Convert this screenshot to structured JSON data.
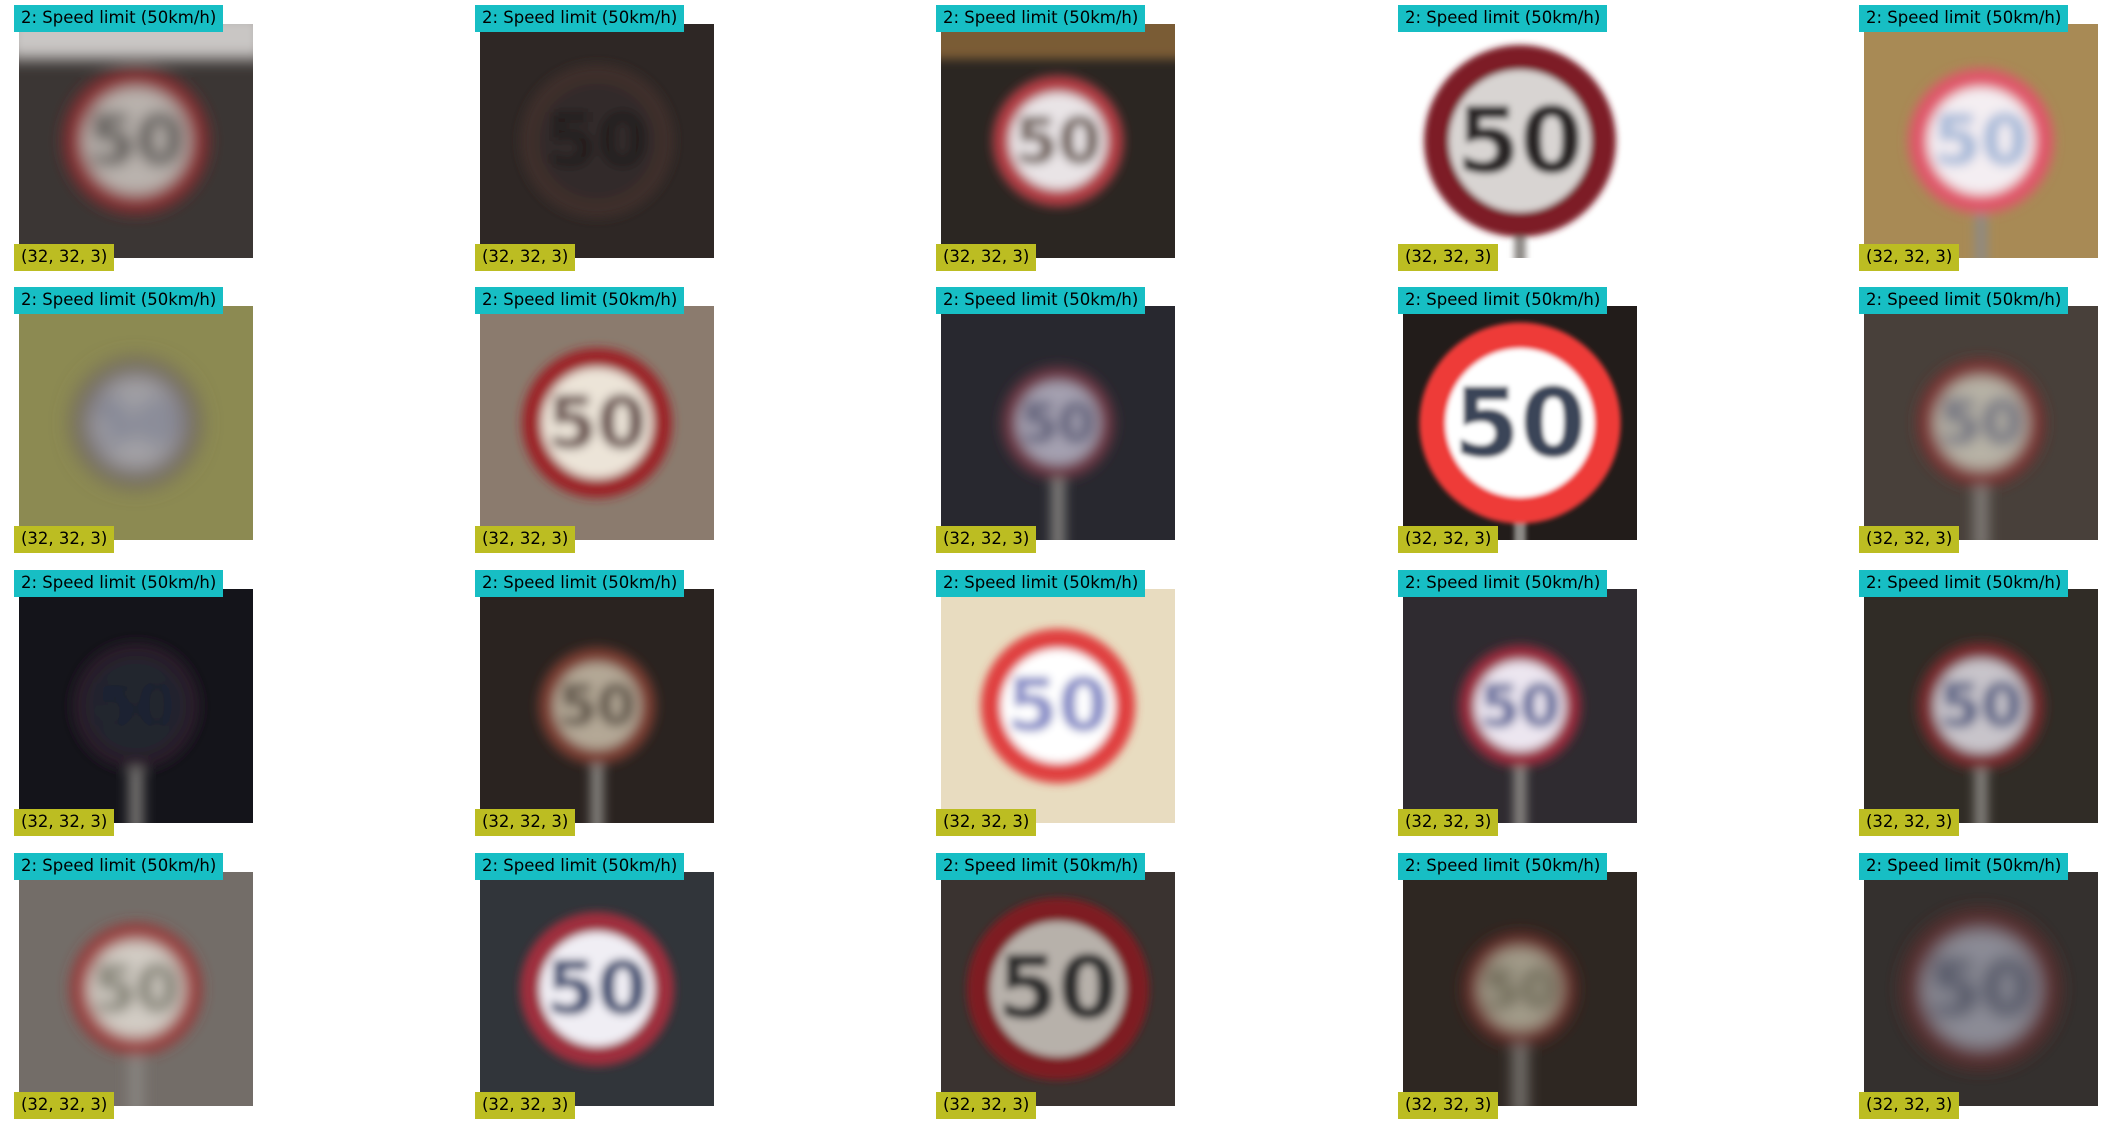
{
  "colors": {
    "class_label_bg": "#17bec4",
    "shape_label_bg": "#bcbd22"
  },
  "panels": [
    {
      "class_label": "2: Speed limit (50km/h)",
      "shape": "(32, 32, 3)",
      "bg": "#3b3634",
      "top_band": "#c9c6c4",
      "ring": "#8a2f33",
      "face": "#b9b2ad",
      "digits": "#3d3a38",
      "blur": 3.2,
      "scale": 0.62,
      "pole": false
    },
    {
      "class_label": "2: Speed limit (50km/h)",
      "shape": "(32, 32, 3)",
      "bg": "#2e2725",
      "top_band": "",
      "ring": "#3e2d2b",
      "face": "#332b29",
      "digits": "#231d1c",
      "blur": 2.2,
      "scale": 0.66,
      "pole": false
    },
    {
      "class_label": "2: Speed limit (50km/h)",
      "shape": "(32, 32, 3)",
      "bg": "#2b2622",
      "top_band": "#7a5b34",
      "ring": "#b23d45",
      "face": "#e9e4e6",
      "digits": "#5d4a3c",
      "blur": 2.2,
      "scale": 0.56,
      "pole": false
    },
    {
      "class_label": "2: Speed limit (50km/h)",
      "shape": "(32, 32, 3)",
      "bg": "#ffffff",
      "top_band": "",
      "ring": "#7d1f26",
      "face": "#d8d4d2",
      "digits": "#2b2727",
      "blur": 1.4,
      "scale": 0.82,
      "pole": true
    },
    {
      "class_label": "2: Speed limit (50km/h)",
      "shape": "(32, 32, 3)",
      "bg": "#a88a55",
      "top_band": "",
      "ring": "#e0566a",
      "face": "#f4eef2",
      "digits": "#9eb4d6",
      "blur": 2.4,
      "scale": 0.62,
      "pole": true
    },
    {
      "class_label": "2: Speed limit (50km/h)",
      "shape": "(32, 32, 3)",
      "bg": "#8c8a52",
      "top_band": "",
      "ring": "#6a6160",
      "face": "#a6a4a8",
      "digits": "#6a7188",
      "blur": 4.6,
      "scale": 0.54,
      "pole": false
    },
    {
      "class_label": "2: Speed limit (50km/h)",
      "shape": "(32, 32, 3)",
      "bg": "#8b7b6e",
      "top_band": "",
      "ring": "#9c2227",
      "face": "#ece4d8",
      "digits": "#5b3d3a",
      "blur": 2.2,
      "scale": 0.64,
      "pole": false
    },
    {
      "class_label": "2: Speed limit (50km/h)",
      "shape": "(32, 32, 3)",
      "bg": "#28282f",
      "top_band": "",
      "ring": "#6e3744",
      "face": "#a4a0b0",
      "digits": "#4c4d6c",
      "blur": 2.6,
      "scale": 0.48,
      "pole": true
    },
    {
      "class_label": "2: Speed limit (50km/h)",
      "shape": "(32, 32, 3)",
      "bg": "#221c1a",
      "top_band": "",
      "ring": "#ee3a38",
      "face": "#ffffff",
      "digits": "#3b4458",
      "blur": 1.0,
      "scale": 0.86,
      "pole": true
    },
    {
      "class_label": "2: Speed limit (50km/h)",
      "shape": "(32, 32, 3)",
      "bg": "#48403a",
      "top_band": "",
      "ring": "#7e3030",
      "face": "#b7b2a6",
      "digits": "#5a5f76",
      "blur": 3.0,
      "scale": 0.54,
      "pole": true
    },
    {
      "class_label": "2: Speed limit (50km/h)",
      "shape": "(32, 32, 3)",
      "bg": "#14141a",
      "top_band": "",
      "ring": "#2b1f29",
      "face": "#24252d",
      "digits": "#1c2430",
      "blur": 2.8,
      "scale": 0.54,
      "pole": true
    },
    {
      "class_label": "2: Speed limit (50km/h)",
      "shape": "(32, 32, 3)",
      "bg": "#2a2320",
      "top_band": "",
      "ring": "#7c3c33",
      "face": "#b4a896",
      "digits": "#4a3c32",
      "blur": 2.4,
      "scale": 0.5,
      "pole": true
    },
    {
      "class_label": "2: Speed limit (50km/h)",
      "shape": "(32, 32, 3)",
      "bg": "#e8dcc0",
      "top_band": "",
      "ring": "#e0413f",
      "face": "#ffffff",
      "digits": "#8a8fc8",
      "blur": 1.8,
      "scale": 0.66,
      "pole": false
    },
    {
      "class_label": "2: Speed limit (50km/h)",
      "shape": "(32, 32, 3)",
      "bg": "#2f2b30",
      "top_band": "",
      "ring": "#9a2c3c",
      "face": "#ece6f0",
      "digits": "#3a4c8c",
      "blur": 2.2,
      "scale": 0.52,
      "pole": true
    },
    {
      "class_label": "2: Speed limit (50km/h)",
      "shape": "(32, 32, 3)",
      "bg": "#302c26",
      "top_band": "",
      "ring": "#7a2c2d",
      "face": "#c8c4ca",
      "digits": "#3a4a78",
      "blur": 2.4,
      "scale": 0.54,
      "pole": true
    },
    {
      "class_label": "2: Speed limit (50km/h)",
      "shape": "(32, 32, 3)",
      "bg": "#736d68",
      "top_band": "",
      "ring": "#9b3737",
      "face": "#d2ccc4",
      "digits": "#6b6a5a",
      "blur": 3.0,
      "scale": 0.56,
      "pole": true
    },
    {
      "class_label": "2: Speed limit (50km/h)",
      "shape": "(32, 32, 3)",
      "bg": "#31353a",
      "top_band": "",
      "ring": "#9e2f3c",
      "face": "#f0eef4",
      "digits": "#3a4870",
      "blur": 1.8,
      "scale": 0.66,
      "pole": false
    },
    {
      "class_label": "2: Speed limit (50km/h)",
      "shape": "(32, 32, 3)",
      "bg": "#3a3330",
      "top_band": "",
      "ring": "#7e1f24",
      "face": "#b7b1aa",
      "digits": "#2c2a2a",
      "blur": 1.6,
      "scale": 0.78,
      "pole": false
    },
    {
      "class_label": "2: Speed limit (50km/h)",
      "shape": "(32, 32, 3)",
      "bg": "#2e2722",
      "top_band": "",
      "ring": "#6c2b28",
      "face": "#a39c8a",
      "digits": "#5a5440",
      "blur": 3.2,
      "scale": 0.48,
      "pole": true
    },
    {
      "class_label": "2: Speed limit (50km/h)",
      "shape": "(32, 32, 3)",
      "bg": "#34302e",
      "top_band": "",
      "ring": "#5c2e2e",
      "face": "#8c8c96",
      "digits": "#3c4256",
      "blur": 3.6,
      "scale": 0.68,
      "pole": false
    }
  ]
}
